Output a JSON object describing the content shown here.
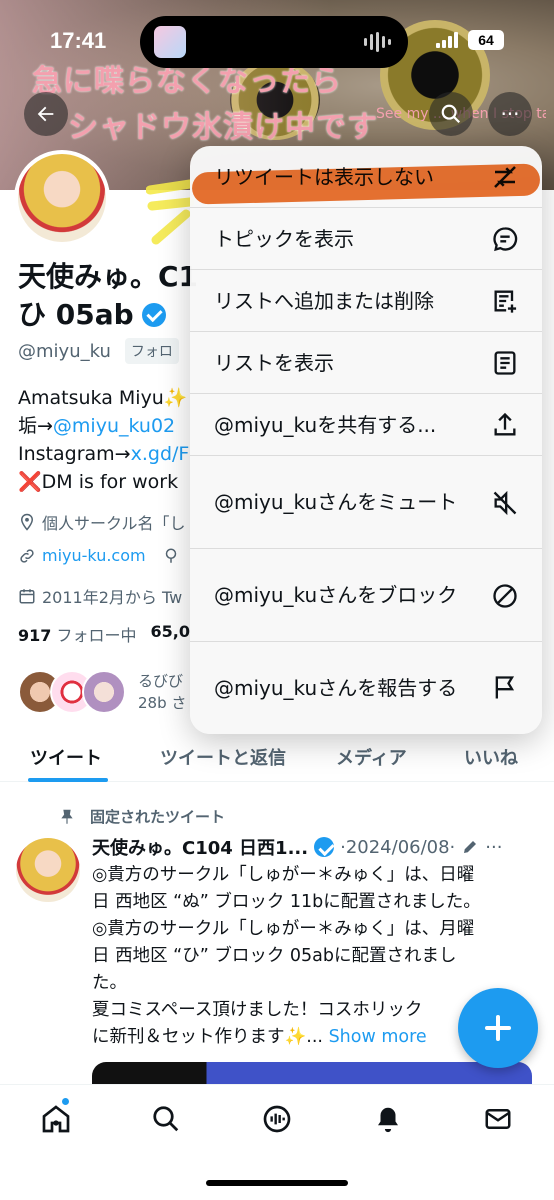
{
  "status_bar": {
    "time": "17:41",
    "battery": "64"
  },
  "banner": {
    "line1": "急に喋らなくなったら",
    "line2": "シャドウ氷漬け中です",
    "small": "See my ... when I stop talking"
  },
  "profile": {
    "name_line1": "天使みゅ。C1",
    "name_line2": "ひ 05ab",
    "handle": "@miyu_ku",
    "follows_you": "フォロ",
    "bio_line1": "Amatsuka Miyu✨",
    "bio_line2_prefix": "垢→",
    "bio_line2_link": "@miyu_ku02",
    "bio_line3_prefix": "Instagram→",
    "bio_line3_link": "x.gd/F",
    "bio_line4": "❌DM is for work",
    "location": "個人サークル名「し",
    "website": "miyu-ku.com",
    "joined": "2011年2月から Tw",
    "following_count": "917",
    "following_label": "フォロー中",
    "followers_count": "65,0",
    "followed_by_line1": "るびび",
    "followed_by_line2": "28b さ"
  },
  "tabs": [
    {
      "label": "ツイート"
    },
    {
      "label": "ツイートと返信"
    },
    {
      "label": "メディア"
    },
    {
      "label": "いいね"
    }
  ],
  "tweet": {
    "pinned_label": "固定されたツイート",
    "author": "天使みゅ。C104 日西1...",
    "date": "·2024/06/08·",
    "body_line1": "◎貴方のサークル「しゅがー＊みゅく」は、日曜",
    "body_line2": "日 西地区 “ぬ” ブロック 11bに配置されました。",
    "body_line3": "◎貴方のサークル「しゅがー＊みゅく」は、月曜",
    "body_line4": "日 西地区 “ひ” ブロック 05abに配置されまし",
    "body_line5": "た。",
    "body_line6": "夏コミスペース頂けました！コスホリック",
    "body_line7": "に新刊＆セット作ります✨...",
    "show_more": "Show more"
  },
  "menu": {
    "items": [
      {
        "label": "リツイートは表示しない",
        "icon": "retweet-off-icon"
      },
      {
        "label": "トピックを表示",
        "icon": "topic-icon"
      },
      {
        "label": "リストへ追加または削除",
        "icon": "list-add-icon"
      },
      {
        "label": "リストを表示",
        "icon": "list-icon"
      },
      {
        "label": "@miyu_kuを共有する...",
        "icon": "share-icon"
      },
      {
        "label": "@miyu_kuさんをミュート",
        "icon": "mute-icon"
      },
      {
        "label": "@miyu_kuさんをブロック",
        "icon": "block-icon"
      },
      {
        "label": "@miyu_kuさんを報告する",
        "icon": "flag-icon"
      }
    ]
  },
  "colors": {
    "accent": "#1d9bf0",
    "highlight": "#e86014"
  }
}
